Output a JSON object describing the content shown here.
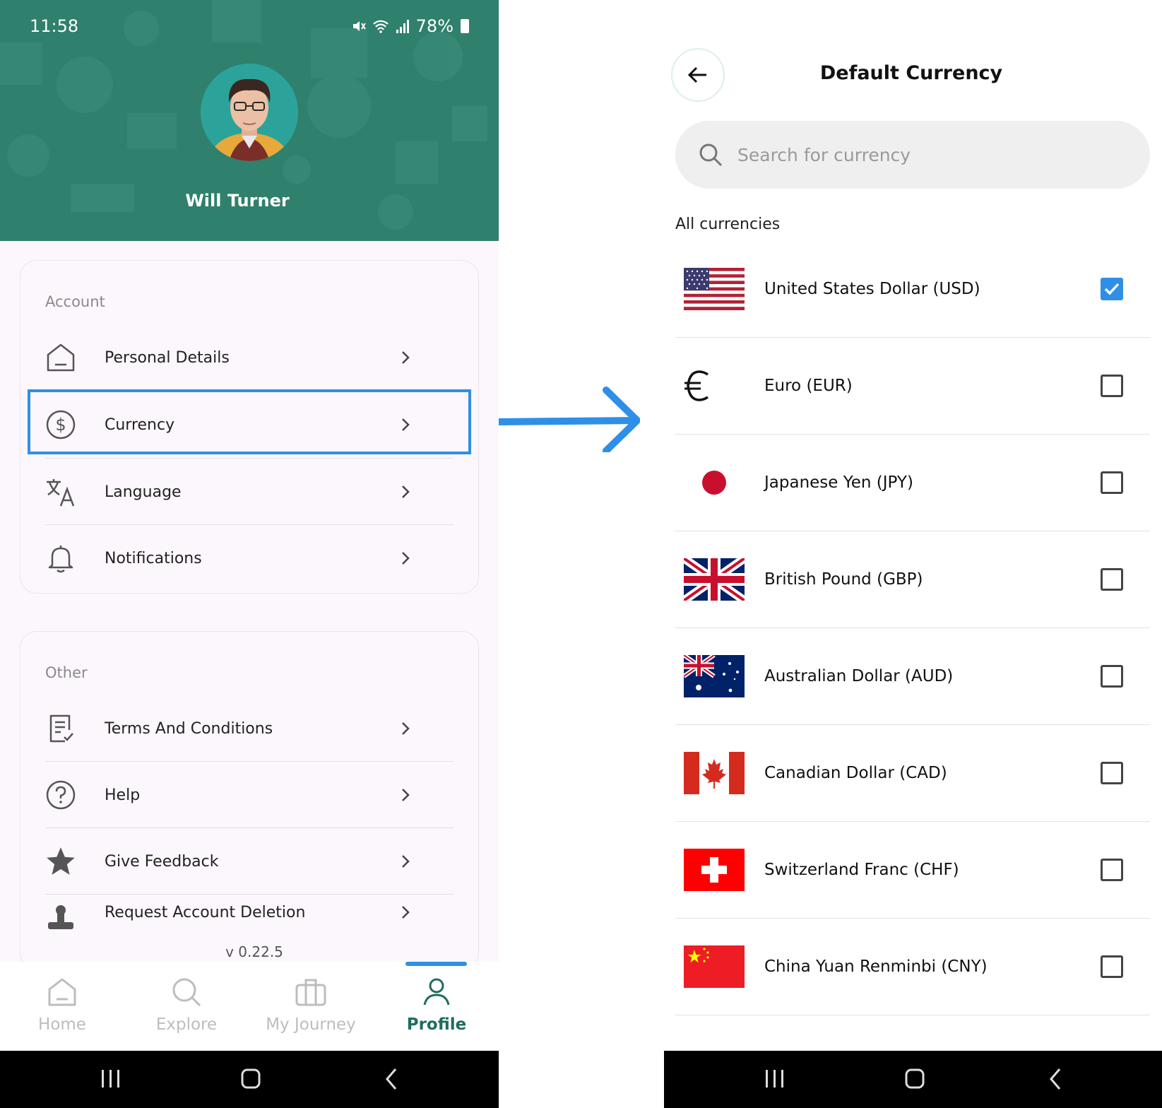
{
  "left_screen": {
    "status_bar": {
      "time": "11:58",
      "battery": "78%"
    },
    "profile": {
      "name": "Will Turner"
    },
    "account_section": {
      "title": "Account",
      "items": [
        {
          "label": "Personal Details",
          "icon": "home-icon"
        },
        {
          "label": "Currency",
          "icon": "dollar-circle-icon",
          "highlighted": true
        },
        {
          "label": "Language",
          "icon": "translate-icon"
        },
        {
          "label": "Notifications",
          "icon": "bell-icon"
        }
      ]
    },
    "other_section": {
      "title": "Other",
      "items": [
        {
          "label": "Terms And Conditions",
          "icon": "document-check-icon"
        },
        {
          "label": "Help",
          "icon": "question-circle-icon"
        },
        {
          "label": "Give Feedback",
          "icon": "star-icon"
        },
        {
          "label": "Request Account Deletion",
          "icon": "stamp-icon"
        }
      ]
    },
    "version": "v 0.22.5",
    "bottom_nav": [
      {
        "label": "Home",
        "icon": "home-icon",
        "active": false
      },
      {
        "label": "Explore",
        "icon": "search-icon",
        "active": false
      },
      {
        "label": "My Journey",
        "icon": "briefcase-icon",
        "active": false
      },
      {
        "label": "Profile",
        "icon": "person-icon",
        "active": true
      }
    ]
  },
  "right_screen": {
    "title": "Default Currency",
    "search": {
      "placeholder": "Search for currency",
      "value": ""
    },
    "section_label": "All currencies",
    "currencies": [
      {
        "label": "United States Dollar (USD)",
        "flag": "us-flag",
        "checked": true
      },
      {
        "label": "Euro (EUR)",
        "flag": "euro-sign",
        "checked": false
      },
      {
        "label": "Japanese Yen (JPY)",
        "flag": "japan-flag",
        "checked": false
      },
      {
        "label": "British Pound (GBP)",
        "flag": "uk-flag",
        "checked": false
      },
      {
        "label": "Australian Dollar (AUD)",
        "flag": "australia-flag",
        "checked": false
      },
      {
        "label": "Canadian Dollar (CAD)",
        "flag": "canada-flag",
        "checked": false
      },
      {
        "label": "Switzerland Franc (CHF)",
        "flag": "switzerland-flag",
        "checked": false
      },
      {
        "label": "China Yuan Renminbi (CNY)",
        "flag": "china-flag",
        "checked": false
      }
    ]
  },
  "colors": {
    "header_green": "#2f806c",
    "accent_blue": "#2f8fe6",
    "active_nav": "#1f6e5c"
  }
}
